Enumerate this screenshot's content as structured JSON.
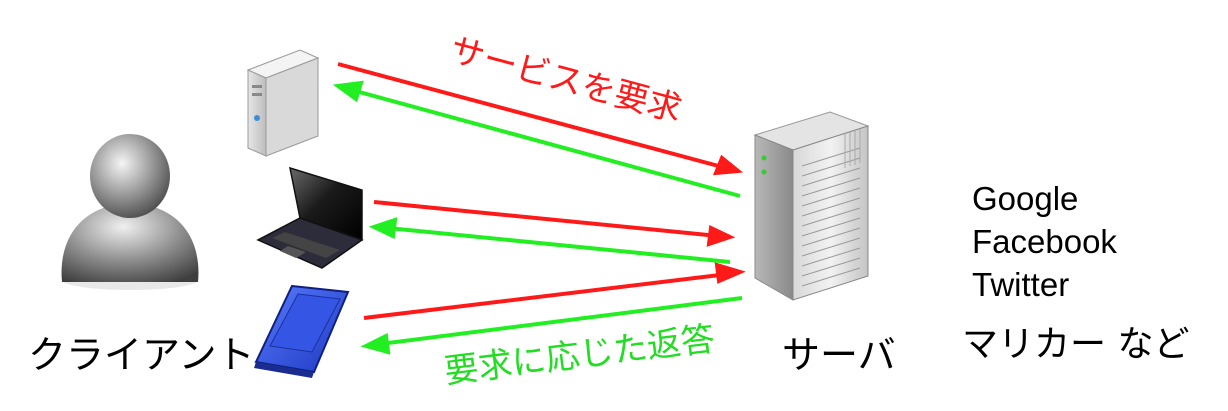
{
  "labels": {
    "client": "クライアント",
    "server": "サーバ",
    "request": "サービスを要求",
    "response": "要求に応じた返答"
  },
  "services": [
    "Google",
    "Facebook",
    "Twitter",
    "マリカー など"
  ],
  "colors": {
    "request_arrow": "#ff1a1a",
    "response_arrow": "#22ee22",
    "request_text": "#ff1a1a",
    "response_text": "#22dd22",
    "tablet": "#2a4cd8"
  }
}
